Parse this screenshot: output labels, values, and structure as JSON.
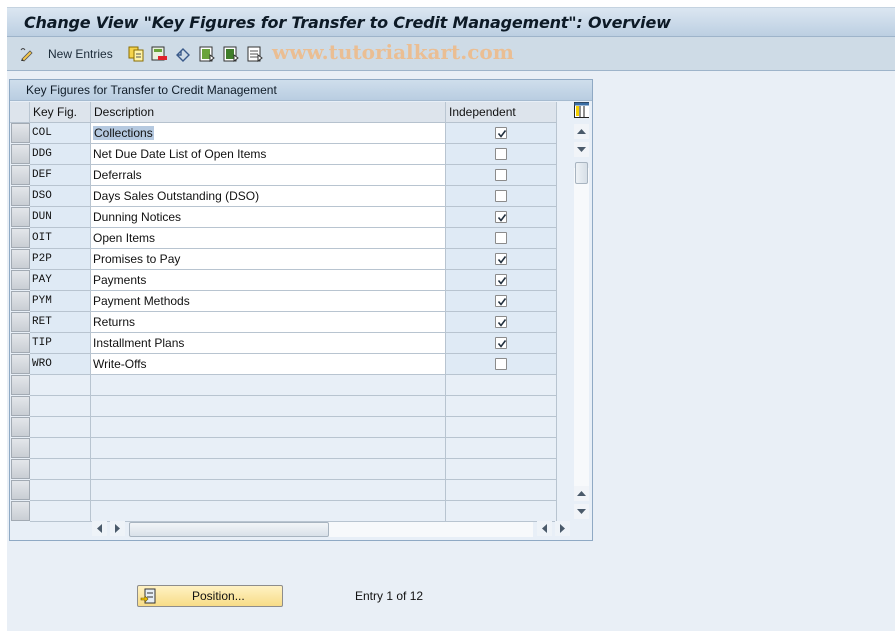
{
  "window": {
    "title": "Change View \"Key Figures for Transfer to Credit Management\": Overview"
  },
  "toolbar": {
    "items": [
      {
        "icon": "edit-pencil-icon",
        "label": ""
      },
      {
        "icon": "",
        "label": "New Entries"
      },
      {
        "icon": "copy-as-icon",
        "label": ""
      },
      {
        "icon": "delete-icon",
        "label": ""
      },
      {
        "icon": "undo-change-icon",
        "label": ""
      },
      {
        "icon": "select-all-icon",
        "label": ""
      },
      {
        "icon": "select-block-icon",
        "label": ""
      },
      {
        "icon": "deselect-all-icon",
        "label": ""
      }
    ],
    "watermark": "www.tutorialkart.com"
  },
  "table": {
    "title": "Key Figures for Transfer to Credit Management",
    "columns": [
      "Key Fig.",
      "Description",
      "Independent"
    ],
    "rows": [
      {
        "key": "COL",
        "description": "Collections",
        "independent": true,
        "selected": true
      },
      {
        "key": "DDG",
        "description": "Net Due Date List of Open Items",
        "independent": false
      },
      {
        "key": "DEF",
        "description": "Deferrals",
        "independent": false
      },
      {
        "key": "DSO",
        "description": "Days Sales Outstanding (DSO)",
        "independent": false
      },
      {
        "key": "DUN",
        "description": "Dunning Notices",
        "independent": true
      },
      {
        "key": "OIT",
        "description": "Open Items",
        "independent": false
      },
      {
        "key": "P2P",
        "description": "Promises to Pay",
        "independent": true
      },
      {
        "key": "PAY",
        "description": "Payments",
        "independent": true
      },
      {
        "key": "PYM",
        "description": "Payment Methods",
        "independent": true
      },
      {
        "key": "RET",
        "description": "Returns",
        "independent": true
      },
      {
        "key": "TIP",
        "description": "Installment Plans",
        "independent": true
      },
      {
        "key": "WRO",
        "description": "Write-Offs",
        "independent": false
      }
    ],
    "empty_rows": 7
  },
  "footer": {
    "position_button": "Position...",
    "entry_text": "Entry 1 of 12"
  }
}
